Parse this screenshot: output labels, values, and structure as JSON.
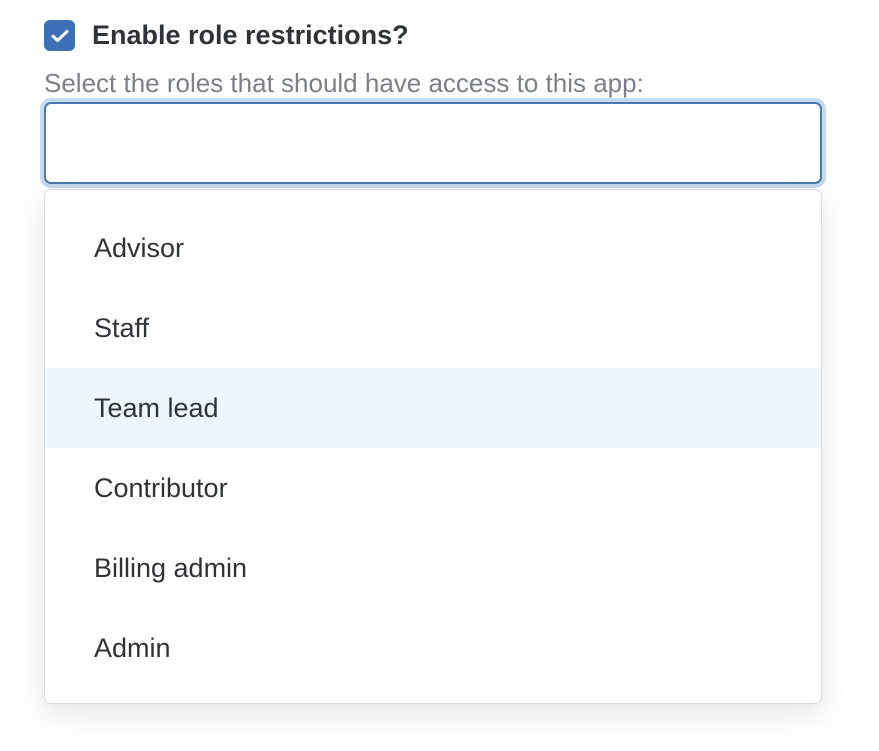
{
  "restriction": {
    "checkbox_checked": true,
    "label": "Enable role restrictions?",
    "help_text": "Select the roles that should have access to this app:"
  },
  "roles_select": {
    "value": "",
    "placeholder": "",
    "highlighted_option": "Team lead",
    "options": [
      {
        "label": "Advisor"
      },
      {
        "label": "Staff"
      },
      {
        "label": "Team lead"
      },
      {
        "label": "Contributor"
      },
      {
        "label": "Billing admin"
      },
      {
        "label": "Admin"
      }
    ]
  },
  "colors": {
    "accent": "#3b6fb6",
    "focus_ring": "#c7d9ec",
    "highlight": "#eef5fd",
    "text": "#2f3338",
    "muted_text": "#7b8088"
  }
}
